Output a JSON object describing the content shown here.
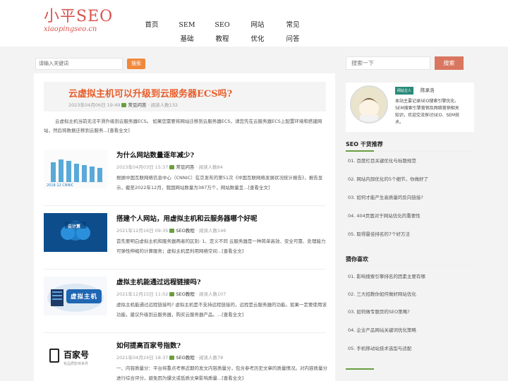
{
  "logo": {
    "main": "小平SEO",
    "sub": "xiaopingseo.cn"
  },
  "nav": [
    {
      "line1": "首页",
      "line2": ""
    },
    {
      "line1": "SEM",
      "line2": "基础"
    },
    {
      "line1": "SEO",
      "line2": "教程"
    },
    {
      "line1": "网站",
      "line2": "优化"
    },
    {
      "line1": "常见",
      "line2": "问答"
    }
  ],
  "search": {
    "placeholder": "请输入关键词",
    "button": "搜索"
  },
  "featured": {
    "title": "云虚拟主机可以升级到云服务器ECS吗?",
    "date": "2023年04月06日 19:49",
    "category": "常见问答",
    "reads": "· 阅读人数132",
    "excerpt": "云虚拟主机当前无法平滑升级到云服务器ECS。 如果您需要将网站迁移到云服务器ECS，请您先在云服务器ECS上配置环境和搭建网站，然后将数据迁移到云服务...[查看全文]"
  },
  "posts": [
    {
      "title": "为什么网站数量逐年减少?",
      "date": "2023年04月03日 15:37",
      "category": "常见问答",
      "reads": "· 阅读人数84",
      "excerpt": "根据中国互联网络信息中心（CNNIC）在京发布的第51次《中国互联网络发展状况统计报告》，报告显示，截至2022年12月，我国网站数量为387万个，网站数量呈...[查看全文]",
      "thumb_caption": "2018.12  CNNIC"
    },
    {
      "title": "搭建个人网站，用虚拟主机和云服务器哪个好呢",
      "date": "2021年12月16日 09:35",
      "category": "SEO教程",
      "reads": "· 阅读人数146",
      "excerpt": "首先要明白虚拟主机和服务器两者的区别: 1、定义不同 云服务器是一种简单高效、安全可靠、处理能力可弹性伸缩的计算服务；虚拟主机是利用网络空间...[查看全文]",
      "thumb_caption": "云计算"
    },
    {
      "title": "虚拟主机能通过远程链接吗?",
      "date": "2021年12月15日 11:02",
      "category": "SEO教程",
      "reads": "· 阅读人数107",
      "excerpt": "虚拟主机能通过远程链接吗? 虚拟主机是不支持远程链接的，远程是云服务器的功能。如果一定要使用该功能，建议升级到云服务器，购买云服务器产品。...[查看全文]",
      "thumb_caption": "虚拟主机"
    },
    {
      "title": "如何提高百家号指数?",
      "date": "2021年04月24日 18:37",
      "category": "SEO教程",
      "reads": "· 阅读人数78",
      "excerpt": "一、内容质量分：平台将重点考察近期的发文内容质量分，包含参考历史文章的质量情况。对内容质量分进行综合评分，避免因为爆文或低质文章影响质量...[查看全文]",
      "thumb_caption": "百家号",
      "thumb_sub": "有品质影响世界"
    }
  ],
  "sidebar": {
    "search_placeholder": "搜索一下",
    "search_button": "搜索",
    "profile": {
      "role": "网站主人",
      "name": "陈承浩",
      "bio": "本站主要记录SEO搜索引擎优化、SEM搜索引擎营销及网络营销相关知识，欢迎交流探讨SEO、SEM技术。"
    },
    "dry_title": "SEO 干货推荐",
    "dry_items": [
      "01. 百度栏目关键优化与标题规范",
      "02. 网站内部优化的5个细节，你做好了",
      "03. 如何才能产生高质量的反向链接?",
      "04. 404页面对于网站优化的重要性",
      "05. 取得最佳排名的7个好方法"
    ],
    "like_title": "猜你喜欢",
    "like_items": [
      "01. 影响搜索引擎排名的因素主要有哪",
      "02. 三大招教你如何做好网站优化",
      "03. 如何做专题页的SEO策略?",
      "04. 企业产品网站关键词优化策略",
      "05. 手机移动站技术选型与适配"
    ]
  },
  "colors": {
    "accent": "#e85d2a",
    "brand": "#d9534f",
    "green": "#6a9e3f",
    "search_btn": "#f0883a"
  }
}
